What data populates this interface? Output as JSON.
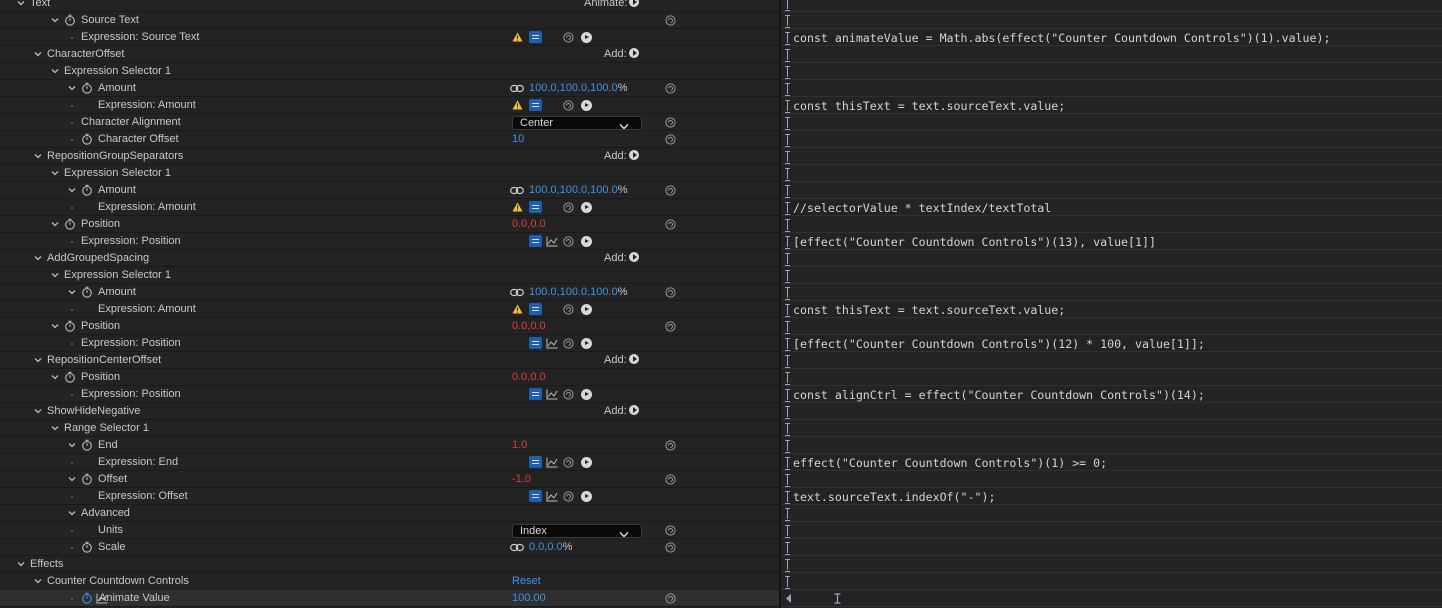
{
  "header": {
    "animate_label": "Animate:",
    "add_label": "Add:"
  },
  "rows": [
    {
      "name": "Text",
      "indent": 0,
      "twirl": "open",
      "stopwatch": false,
      "header": "animate"
    },
    {
      "name": "Source Text",
      "indent": 2,
      "twirl": "open",
      "stopwatch": true,
      "swirl": true
    },
    {
      "name": "Expression: Source Text",
      "indent": 3,
      "twirl": "none",
      "expr": true,
      "warn": true,
      "graph": false,
      "code": "const animateValue = Math.abs(effect(\"Counter Countdown Controls\")(1).value);"
    },
    {
      "name": "CharacterOffset",
      "indent": 1,
      "twirl": "open",
      "header": "add"
    },
    {
      "name": "Expression Selector 1",
      "indent": 2,
      "twirl": "open"
    },
    {
      "name": "Amount",
      "indent": 3,
      "twirl": "open",
      "stopwatch": true,
      "link": true,
      "values": [
        {
          "t": "100.0,100.0,100.0",
          "c": "blue"
        },
        {
          "t": "%",
          "c": "white"
        }
      ],
      "swirl": true
    },
    {
      "name": "Expression: Amount",
      "indent": 5,
      "twirl": "none",
      "expr": true,
      "warn": true,
      "graph": false,
      "code": "const thisText = text.sourceText.value;"
    },
    {
      "name": "Character Alignment",
      "indent": 3,
      "twirl": "none",
      "dropdown": "Center",
      "swirl": true
    },
    {
      "name": "Character Offset",
      "indent": 3,
      "twirl": "none",
      "stopwatch": true,
      "values": [
        {
          "t": "10",
          "c": "blue"
        }
      ],
      "swirl": true
    },
    {
      "name": "RepositionGroupSeparators",
      "indent": 1,
      "twirl": "open",
      "header": "add"
    },
    {
      "name": "Expression Selector 1",
      "indent": 2,
      "twirl": "open"
    },
    {
      "name": "Amount",
      "indent": 3,
      "twirl": "open",
      "stopwatch": true,
      "link": true,
      "values": [
        {
          "t": "100.0,100.0,100.0",
          "c": "blue"
        },
        {
          "t": "%",
          "c": "white"
        }
      ],
      "swirl": true
    },
    {
      "name": "Expression: Amount",
      "indent": 5,
      "twirl": "none",
      "expr": true,
      "warn": true,
      "graph": false,
      "code": "//selectorValue * textIndex/textTotal"
    },
    {
      "name": "Position",
      "indent": 2,
      "twirl": "open",
      "stopwatch": true,
      "values": [
        {
          "t": "0.0,0.0",
          "c": "red"
        }
      ],
      "swirl": true
    },
    {
      "name": "Expression: Position",
      "indent": 4,
      "twirl": "none",
      "expr": true,
      "warn": false,
      "graph": true,
      "code": "[effect(\"Counter Countdown Controls\")(13), value[1]]"
    },
    {
      "name": "AddGroupedSpacing",
      "indent": 1,
      "twirl": "open",
      "header": "add"
    },
    {
      "name": "Expression Selector 1",
      "indent": 2,
      "twirl": "open"
    },
    {
      "name": "Amount",
      "indent": 3,
      "twirl": "open",
      "stopwatch": true,
      "link": true,
      "values": [
        {
          "t": "100.0,100.0,100.0",
          "c": "blue"
        },
        {
          "t": "%",
          "c": "white"
        }
      ],
      "swirl": true
    },
    {
      "name": "Expression: Amount",
      "indent": 5,
      "twirl": "none",
      "expr": true,
      "warn": true,
      "graph": false,
      "code": "const thisText = text.sourceText.value;"
    },
    {
      "name": "Position",
      "indent": 2,
      "twirl": "open",
      "stopwatch": true,
      "values": [
        {
          "t": "0.0,0.0",
          "c": "red"
        }
      ],
      "swirl": true
    },
    {
      "name": "Expression: Position",
      "indent": 4,
      "twirl": "none",
      "expr": true,
      "warn": false,
      "graph": true,
      "code": "[effect(\"Counter Countdown Controls\")(12) * 100, value[1]];"
    },
    {
      "name": "RepositionCenterOffset",
      "indent": 1,
      "twirl": "open",
      "header": "add"
    },
    {
      "name": "Position",
      "indent": 2,
      "twirl": "open",
      "stopwatch": true,
      "values": [
        {
          "t": "0.0,0.0",
          "c": "red"
        }
      ]
    },
    {
      "name": "Expression: Position",
      "indent": 4,
      "twirl": "none",
      "expr": true,
      "warn": false,
      "graph": true,
      "code": "const alignCtrl = effect(\"Counter Countdown Controls\")(14);"
    },
    {
      "name": "ShowHideNegative",
      "indent": 1,
      "twirl": "open",
      "header": "add"
    },
    {
      "name": "Range Selector 1",
      "indent": 2,
      "twirl": "open"
    },
    {
      "name": "End",
      "indent": 3,
      "twirl": "open",
      "stopwatch": true,
      "values": [
        {
          "t": "1.0",
          "c": "red"
        }
      ],
      "swirl": true
    },
    {
      "name": "Expression: End",
      "indent": 5,
      "twirl": "none",
      "expr": true,
      "warn": false,
      "graph": true,
      "code": "effect(\"Counter Countdown Controls\")(1) >= 0;"
    },
    {
      "name": "Offset",
      "indent": 3,
      "twirl": "open",
      "stopwatch": true,
      "values": [
        {
          "t": "-1.0",
          "c": "red"
        }
      ],
      "swirl": true
    },
    {
      "name": "Expression: Offset",
      "indent": 5,
      "twirl": "none",
      "expr": true,
      "warn": false,
      "graph": true,
      "code": "text.sourceText.indexOf(\"-\");"
    },
    {
      "name": "Advanced",
      "indent": 3,
      "twirl": "open"
    },
    {
      "name": "Units",
      "indent": 5,
      "twirl": "none",
      "dropdown": "Index",
      "swirl": true
    },
    {
      "name": "Scale",
      "indent": 3,
      "twirl": "none",
      "stopwatch": true,
      "link": true,
      "values": [
        {
          "t": "0.0,0.0",
          "c": "blue"
        },
        {
          "t": "%",
          "c": "white"
        }
      ],
      "swirl": true
    },
    {
      "name": "Effects",
      "indent": 0,
      "twirl": "open"
    },
    {
      "name": "Counter Countdown Controls",
      "indent": 1,
      "twirl": "open",
      "reset": "Reset"
    },
    {
      "name": "Animate Value",
      "indent": 3,
      "twirl": "none",
      "stopwatch": true,
      "active": true,
      "graphicon": true,
      "values": [
        {
          "t": "100.00",
          "c": "blue"
        }
      ],
      "swirl": true,
      "selected": true,
      "lastexpr": true
    }
  ]
}
